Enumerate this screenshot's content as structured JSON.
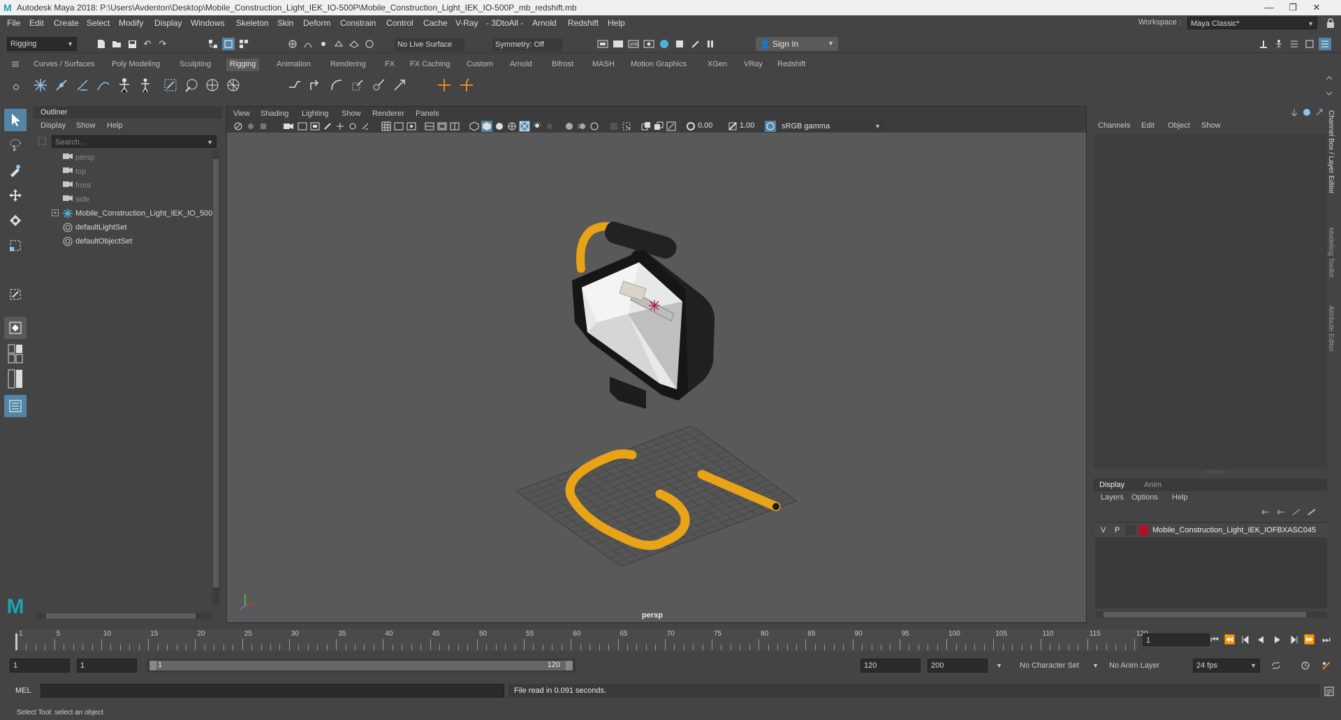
{
  "window": {
    "title": "Autodesk Maya 2018: P:\\Users\\Avdenton\\Desktop\\Mobile_Construction_Light_IEK_IO-500P\\Mobile_Construction_Light_IEK_IO-500P_mb_redshift.mb",
    "logo_letter": "M"
  },
  "menu": [
    "File",
    "Edit",
    "Create",
    "Select",
    "Modify",
    "Display",
    "Windows",
    "Skeleton",
    "Skin",
    "Deform",
    "Constrain",
    "Control",
    "Cache",
    "V-Ray",
    "- 3DtoAll -",
    "Arnold",
    "Redshift",
    "Help"
  ],
  "workspace": {
    "label": "Workspace :",
    "value": "Maya Classic*"
  },
  "status_line": {
    "menuset": "Rigging",
    "live_surface": "No Live Surface",
    "symmetry": "Symmetry: Off",
    "sign_in": "Sign In"
  },
  "shelf": {
    "tabs": [
      "Curves / Surfaces",
      "Poly Modeling",
      "Sculpting",
      "Rigging",
      "Animation",
      "Rendering",
      "FX",
      "FX Caching",
      "Custom",
      "Arnold",
      "Bifrost",
      "MASH",
      "Motion Graphics",
      "XGen",
      "VRay",
      "Redshift"
    ],
    "active_tab": "Rigging"
  },
  "outliner": {
    "title": "Outliner",
    "menu": [
      "Display",
      "Show",
      "Help"
    ],
    "search_placeholder": "Search...",
    "items": [
      {
        "name": "persp",
        "icon": "camera-icon",
        "dim": true
      },
      {
        "name": "top",
        "icon": "camera-icon",
        "dim": true
      },
      {
        "name": "front",
        "icon": "camera-icon",
        "dim": true
      },
      {
        "name": "side",
        "icon": "camera-icon",
        "dim": true
      },
      {
        "name": "Mobile_Construction_Light_IEK_IO_500",
        "icon": "group-star-icon",
        "dim": false,
        "expandable": true
      },
      {
        "name": "defaultLightSet",
        "icon": "set-icon",
        "dim": false
      },
      {
        "name": "defaultObjectSet",
        "icon": "set-icon",
        "dim": false
      }
    ]
  },
  "viewport": {
    "menu": [
      "View",
      "Shading",
      "Lighting",
      "Show",
      "Renderer",
      "Panels"
    ],
    "exposure": "0.00",
    "gamma": "1.00",
    "color_space": "sRGB gamma",
    "camera_label": "persp"
  },
  "channel_box": {
    "menu": [
      "Channels",
      "Edit",
      "Object",
      "Show"
    ],
    "side_tabs": [
      "Channel Box / Layer Editor",
      "Modeling Toolkit",
      "Attribute Editor"
    ]
  },
  "layer_editor": {
    "tabs": [
      "Display",
      "Anim"
    ],
    "active_tab": "Display",
    "menu": [
      "Layers",
      "Options",
      "Help"
    ],
    "layer": {
      "v": "V",
      "p": "P",
      "name": "Mobile_Construction_Light_IEK_IOFBXASC045",
      "color": "#b0102c"
    }
  },
  "timeline": {
    "ticks": [
      "1",
      "5",
      "10",
      "15",
      "20",
      "25",
      "30",
      "35",
      "40",
      "45",
      "50",
      "55",
      "60",
      "65",
      "70",
      "75",
      "80",
      "85",
      "90",
      "95",
      "100",
      "105",
      "110",
      "115",
      "120"
    ],
    "current_frame": "1"
  },
  "range": {
    "start": "1",
    "anim_start": "1",
    "slider_start": "1",
    "slider_end": "120",
    "end": "120",
    "anim_end": "200",
    "character_set": "No Character Set",
    "anim_layer": "No Anim Layer",
    "fps": "24 fps"
  },
  "command_line": {
    "lang": "MEL",
    "result": "File read in  0.091 seconds."
  },
  "help_line": "Select Tool: select an object",
  "colors": {
    "accent": "#5285a6",
    "frame_yellow": "#e8a317",
    "layer_red": "#b0102c"
  }
}
